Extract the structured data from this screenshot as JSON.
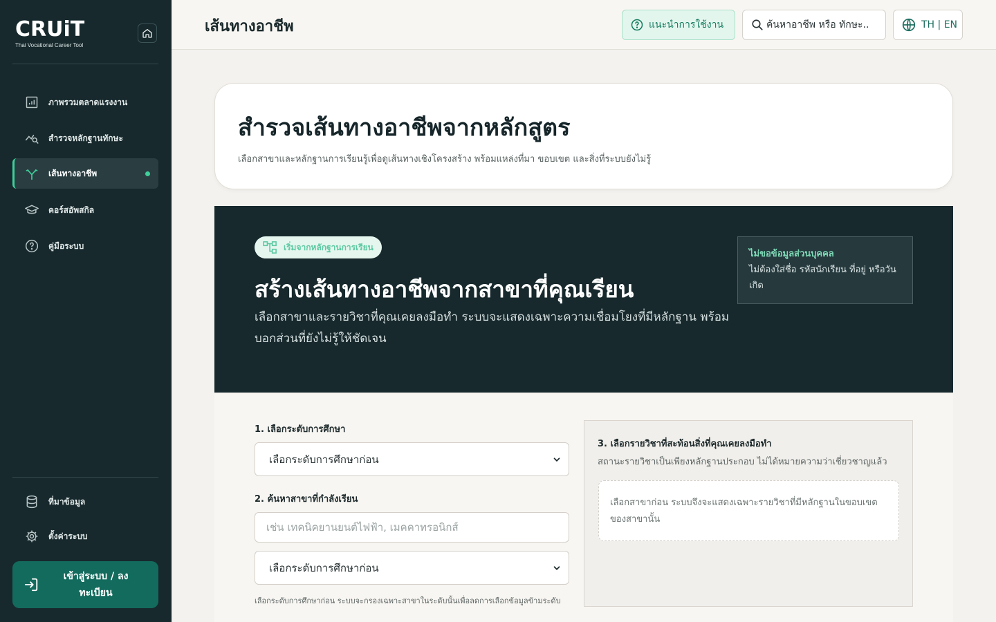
{
  "brand": {
    "logo": "CRUiT",
    "subtitle": "Thai Vocational Career Tool"
  },
  "sidebar": {
    "items": [
      {
        "label": "ภาพรวมตลาดแรงงาน",
        "icon": "bar-chart-icon"
      },
      {
        "label": "สำรวจหลักฐานทักษะ",
        "icon": "trend-search-icon"
      },
      {
        "label": "เส้นทางอาชีพ",
        "icon": "branch-path-icon",
        "active": true
      },
      {
        "label": "คอร์สอัพสกิล",
        "icon": "graduation-cap-icon"
      },
      {
        "label": "คู่มือระบบ",
        "icon": "help-circle-icon"
      }
    ],
    "bottom_items": [
      {
        "label": "ที่มาข้อมูล",
        "icon": "database-icon"
      },
      {
        "label": "ตั้งค่าระบบ",
        "icon": "gear-icon"
      }
    ],
    "login_label": "เข้าสู่ระบบ / ลงทะเบียน"
  },
  "header": {
    "title": "เส้นทางอาชีพ",
    "guide_label": "แนะนำการใช้งาน",
    "search_label": "ค้นหาอาชีพ หรือ ทักษะ..",
    "lang_label": "TH | EN"
  },
  "intro": {
    "title": "สำรวจเส้นทางอาชีพจากหลักสูตร",
    "subtitle": "เลือกสาขาและหลักฐานการเรียนรู้เพื่อดูเส้นทางเชิงโครงสร้าง พร้อมแหล่งที่มา ขอบเขต และสิ่งที่ระบบยังไม่รู้"
  },
  "hero": {
    "badge": "เริ่มจากหลักฐานการเรียน",
    "title": "สร้างเส้นทางอาชีพจากสาขาที่คุณเรียน",
    "description": "เลือกสาขาและรายวิชาที่คุณเคยลงมือทำ ระบบจะแสดงเฉพาะความเชื่อมโยงที่มีหลักฐาน พร้อมบอกส่วนที่ยังไม่รู้ให้ชัดเจน",
    "privacy_title": "ไม่ขอข้อมูลส่วนบุคคล",
    "privacy_text": "ไม่ต้องใส่ชื่อ รหัสนักเรียน ที่อยู่ หรือวันเกิด"
  },
  "form": {
    "step1_label": "1. เลือกระดับการศึกษา",
    "step1_value": "เลือกระดับการศึกษาก่อน",
    "step2_label": "2. ค้นหาสาขาที่กำลังเรียน",
    "step2_placeholder": "เช่น เทคนิคยานยนต์ไฟฟ้า, เมคคาทรอนิกส์",
    "step2_select_value": "เลือกระดับการศึกษาก่อน",
    "hint": "เลือกระดับการศึกษาก่อน ระบบจะกรองเฉพาะสาขาในระดับนั้นเพื่อลดการเลือกข้อมูลข้ามระดับ",
    "step3_label": "3. เลือกรายวิชาที่สะท้อนสิ่งที่คุณเคยลงมือทำ",
    "step3_note": "สถานะรายวิชาเป็นเพียงหลักฐานประกอบ ไม่ได้หมายความว่าเชี่ยวชาญแล้ว",
    "step3_empty": "เลือกสาขาก่อน ระบบจึงจะแสดงเฉพาะรายวิชาที่มีหลักฐานในขอบเขตของสาขานั้น"
  },
  "colors": {
    "sidebar_bg": "#17292d",
    "accent": "#3fcf9a",
    "login_bg": "#136b5d"
  }
}
